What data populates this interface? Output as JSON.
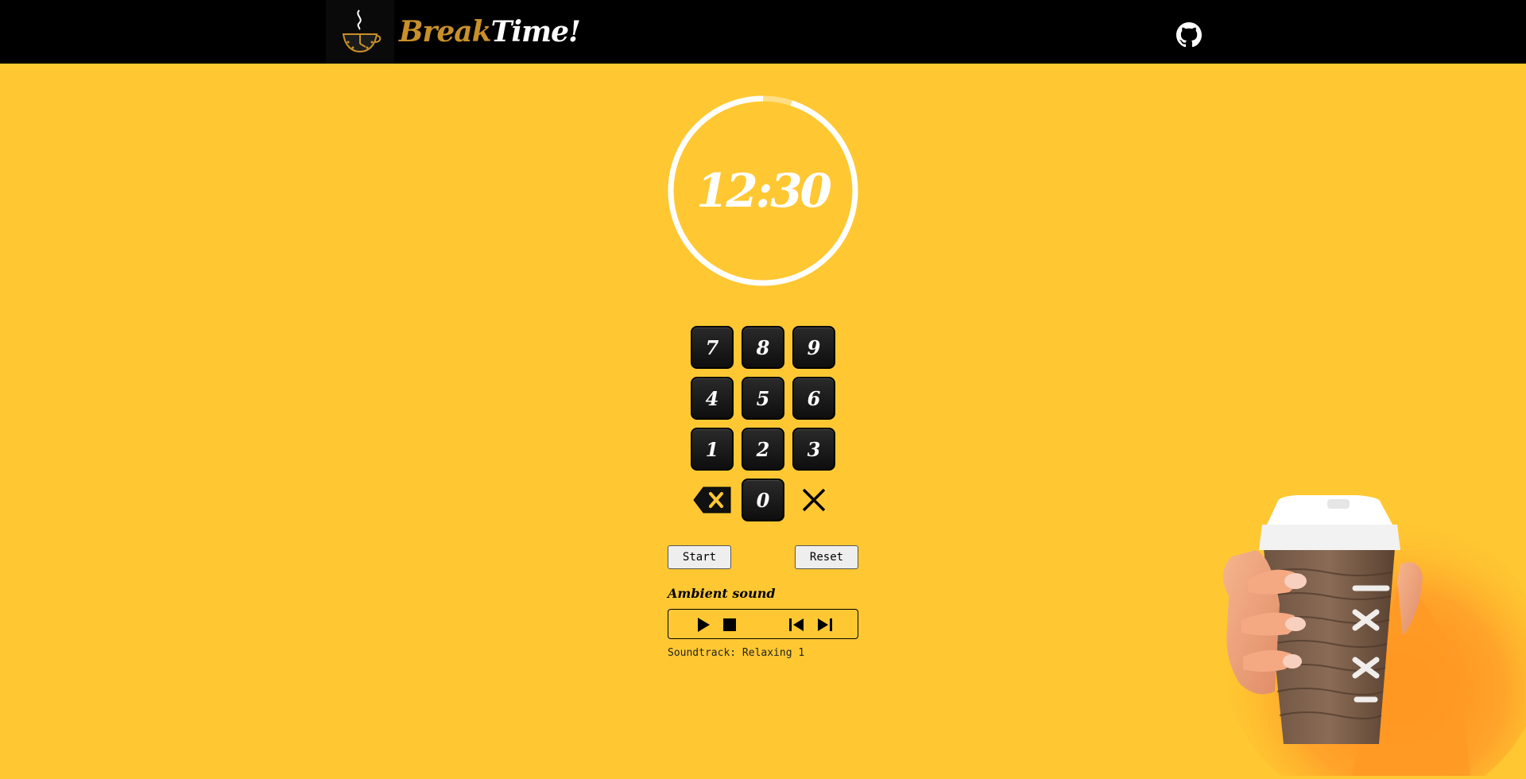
{
  "header": {
    "brand_part1": "Break",
    "brand_part2": "Time!",
    "logo_icon": "coffee-cup-clock-icon",
    "github_icon": "github-icon"
  },
  "timer": {
    "display": "12:30",
    "progress": 0.95
  },
  "keypad": {
    "keys": [
      "7",
      "8",
      "9",
      "4",
      "5",
      "6",
      "1",
      "2",
      "3"
    ],
    "zero": "0",
    "backspace_icon": "backspace-icon",
    "clear_icon": "close-icon"
  },
  "controls": {
    "start_label": "Start",
    "reset_label": "Reset"
  },
  "ambient": {
    "title": "Ambient sound",
    "play_icon": "play-icon",
    "stop_icon": "stop-icon",
    "prev_icon": "skip-previous-icon",
    "next_icon": "skip-next-icon",
    "soundtrack_text": "Soundtrack: Relaxing 1"
  },
  "colors": {
    "background": "#ffc832",
    "header": "#000000",
    "brand_accent": "#c9902a",
    "key_fill": "#151515"
  }
}
